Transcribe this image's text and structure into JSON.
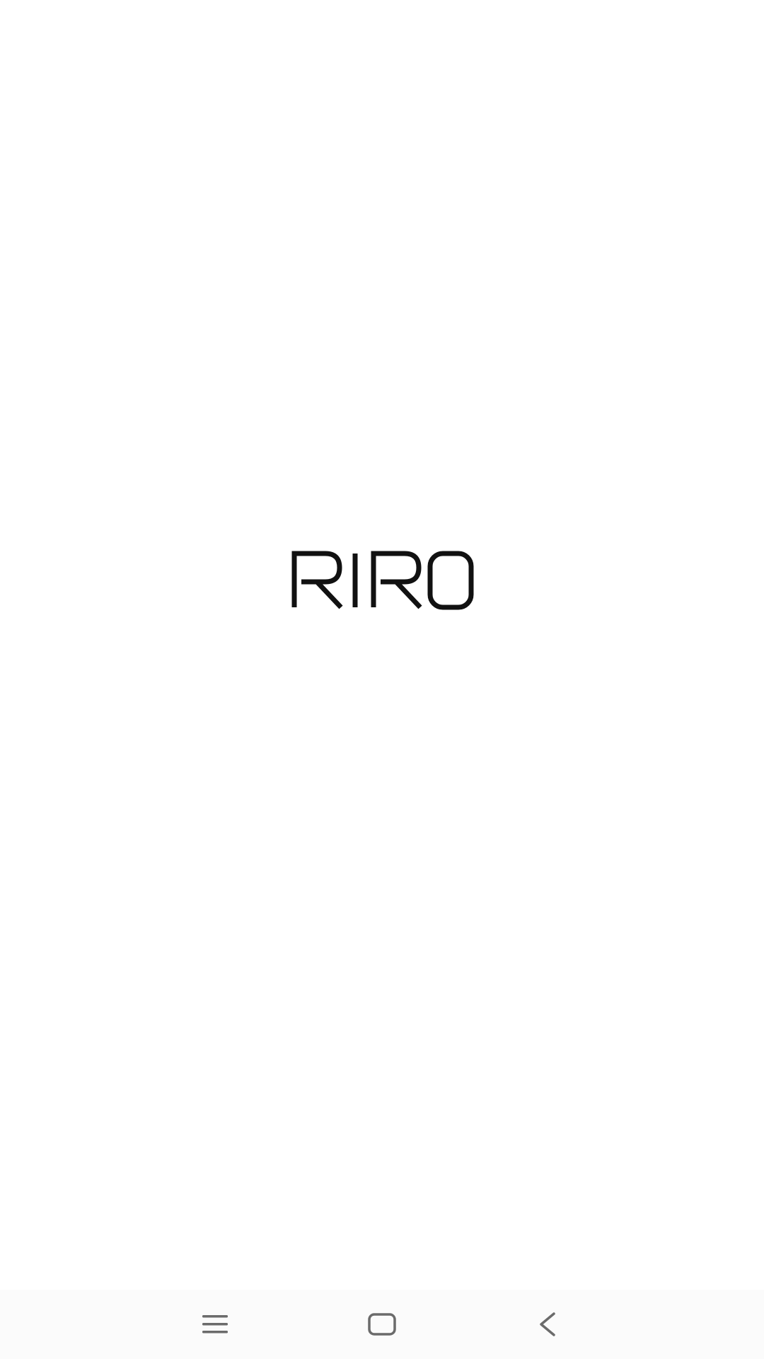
{
  "splash": {
    "logo_text": "RIRO",
    "logo_color": "#111111",
    "background_color": "#ffffff"
  },
  "nav_bar": {
    "background_color": "#fbfbfb",
    "icon_color": "#6b6b6b",
    "buttons": [
      {
        "icon": "menu-icon"
      },
      {
        "icon": "home-icon"
      },
      {
        "icon": "back-icon"
      }
    ]
  }
}
